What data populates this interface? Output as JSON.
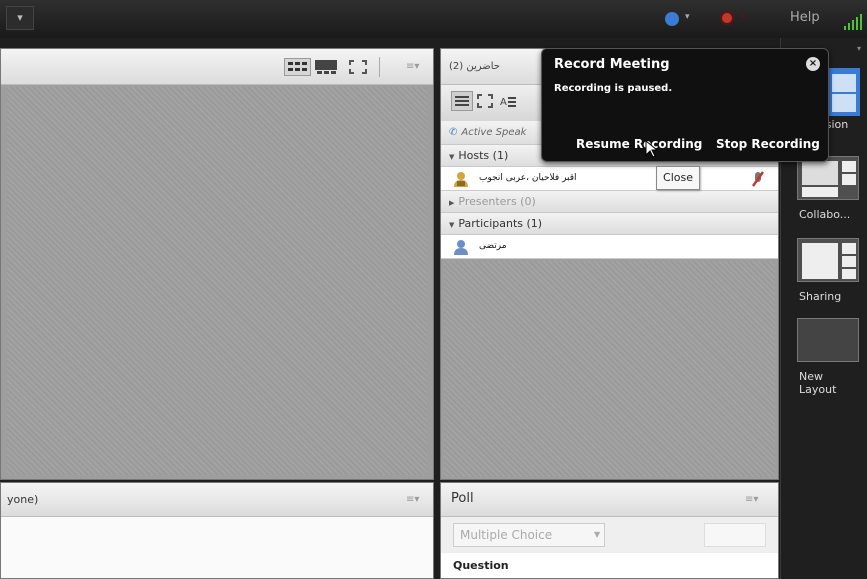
{
  "topbar": {
    "menu_arrow": "▾",
    "info_caret": "▾",
    "rec_caret": "▾",
    "help": "Help"
  },
  "camera_pod": {
    "menu": "≡▾"
  },
  "attendees_pod": {
    "title": "(2)  حاضرين",
    "menu": "≡▾",
    "active_speakers": "Active Speak",
    "hosts": "Hosts (1)",
    "host_name": "اقبر فلاحيان ،عربی انجوب",
    "presenters": "Presenters (0)",
    "participants": "Participants (1)",
    "participant_name": "مرتضی"
  },
  "chat_pod": {
    "title": "yone)",
    "menu": "≡▾"
  },
  "poll_pod": {
    "title": "Poll",
    "menu": "≡▾",
    "type_select": "Multiple Choice",
    "question_label": "Question"
  },
  "record_popup": {
    "title": "Record Meeting",
    "status": "Recording is paused.",
    "resume": "Resume Recording",
    "stop": "Stop Recording"
  },
  "tooltip": {
    "text": "Close"
  },
  "layouts": {
    "items": [
      {
        "label": "ssion"
      },
      {
        "label": "Collabo..."
      },
      {
        "label": "Sharing"
      },
      {
        "label": "New Layout"
      }
    ],
    "scroll_caret": "▾"
  },
  "colors": {
    "accent_blue": "#3a7bd5",
    "record_red": "#c0392b",
    "signal_green": "#52c23a"
  }
}
